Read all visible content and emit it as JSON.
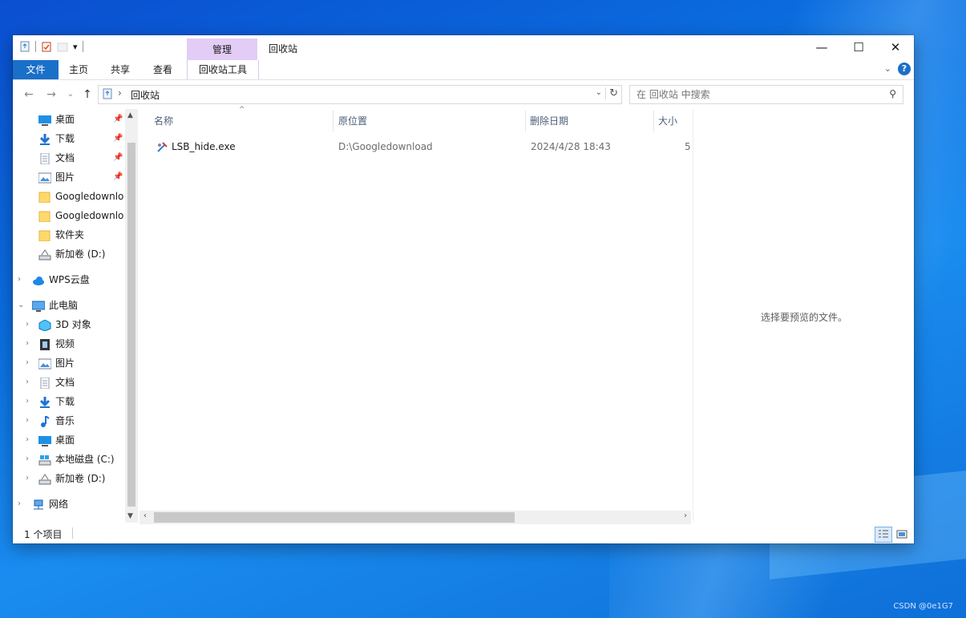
{
  "desktop": {
    "watermark": "CSDN @0e1G7"
  },
  "window": {
    "title": "回收站",
    "context_group": "管理",
    "qat_menu_glyph": "▾",
    "controls": {
      "minimize": "—",
      "maximize": "☐",
      "close": "✕"
    }
  },
  "ribbon": {
    "tabs": [
      "文件",
      "主页",
      "共享",
      "查看",
      "回收站工具"
    ],
    "help": "?",
    "collapse_glyph": "⌄"
  },
  "nav": {
    "back": "←",
    "forward": "→",
    "recent": "⌄",
    "up": "↑",
    "breadcrumb_sep": "›",
    "breadcrumb": "回收站",
    "dropdown": "⌄",
    "refresh": "↻",
    "search_placeholder": "在 回收站 中搜索",
    "search_icon": "⚲"
  },
  "sidebar": {
    "quick_access": [
      {
        "label": "桌面",
        "icon": "desktop-icon",
        "pinned": true
      },
      {
        "label": "下载",
        "icon": "download-icon",
        "pinned": true
      },
      {
        "label": "文档",
        "icon": "document-icon",
        "pinned": true
      },
      {
        "label": "图片",
        "icon": "picture-icon",
        "pinned": true
      },
      {
        "label": "Googledownlo",
        "icon": "folder-icon",
        "pinned": false
      },
      {
        "label": "Googledownlo",
        "icon": "folder-icon",
        "pinned": false
      },
      {
        "label": "软件夹",
        "icon": "folder-icon",
        "pinned": false
      },
      {
        "label": "新加卷 (D:)",
        "icon": "drive-icon",
        "pinned": false
      }
    ],
    "pin_glyph": "📌",
    "expand_glyph": "›",
    "expanded_glyph": "⌄",
    "wps": "WPS云盘",
    "this_pc": "此电脑",
    "this_pc_items": [
      {
        "label": "3D 对象",
        "icon": "3d-objects-icon"
      },
      {
        "label": "视频",
        "icon": "video-icon"
      },
      {
        "label": "图片",
        "icon": "picture-icon"
      },
      {
        "label": "文档",
        "icon": "document-icon"
      },
      {
        "label": "下载",
        "icon": "download-icon"
      },
      {
        "label": "音乐",
        "icon": "music-icon"
      },
      {
        "label": "桌面",
        "icon": "desktop-icon"
      },
      {
        "label": "本地磁盘 (C:)",
        "icon": "local-disk-icon"
      },
      {
        "label": "新加卷 (D:)",
        "icon": "drive-icon"
      }
    ],
    "network": "网络",
    "scroll_up": "▲",
    "scroll_down": "▼"
  },
  "list": {
    "columns": [
      "名称",
      "原位置",
      "删除日期",
      "大小"
    ],
    "sort_indicator": "^",
    "rows": [
      {
        "name": "LSB_hide.exe",
        "location": "D:\\Googledownload",
        "deleted": "2024/4/28 18:43",
        "size": "5"
      }
    ],
    "hscroll_left": "‹",
    "hscroll_right": "›"
  },
  "preview": {
    "message": "选择要预览的文件。"
  },
  "status": {
    "count": "1 个项目"
  },
  "colors": {
    "accent": "#1a6fc9",
    "manage": "#e3cdf7"
  }
}
